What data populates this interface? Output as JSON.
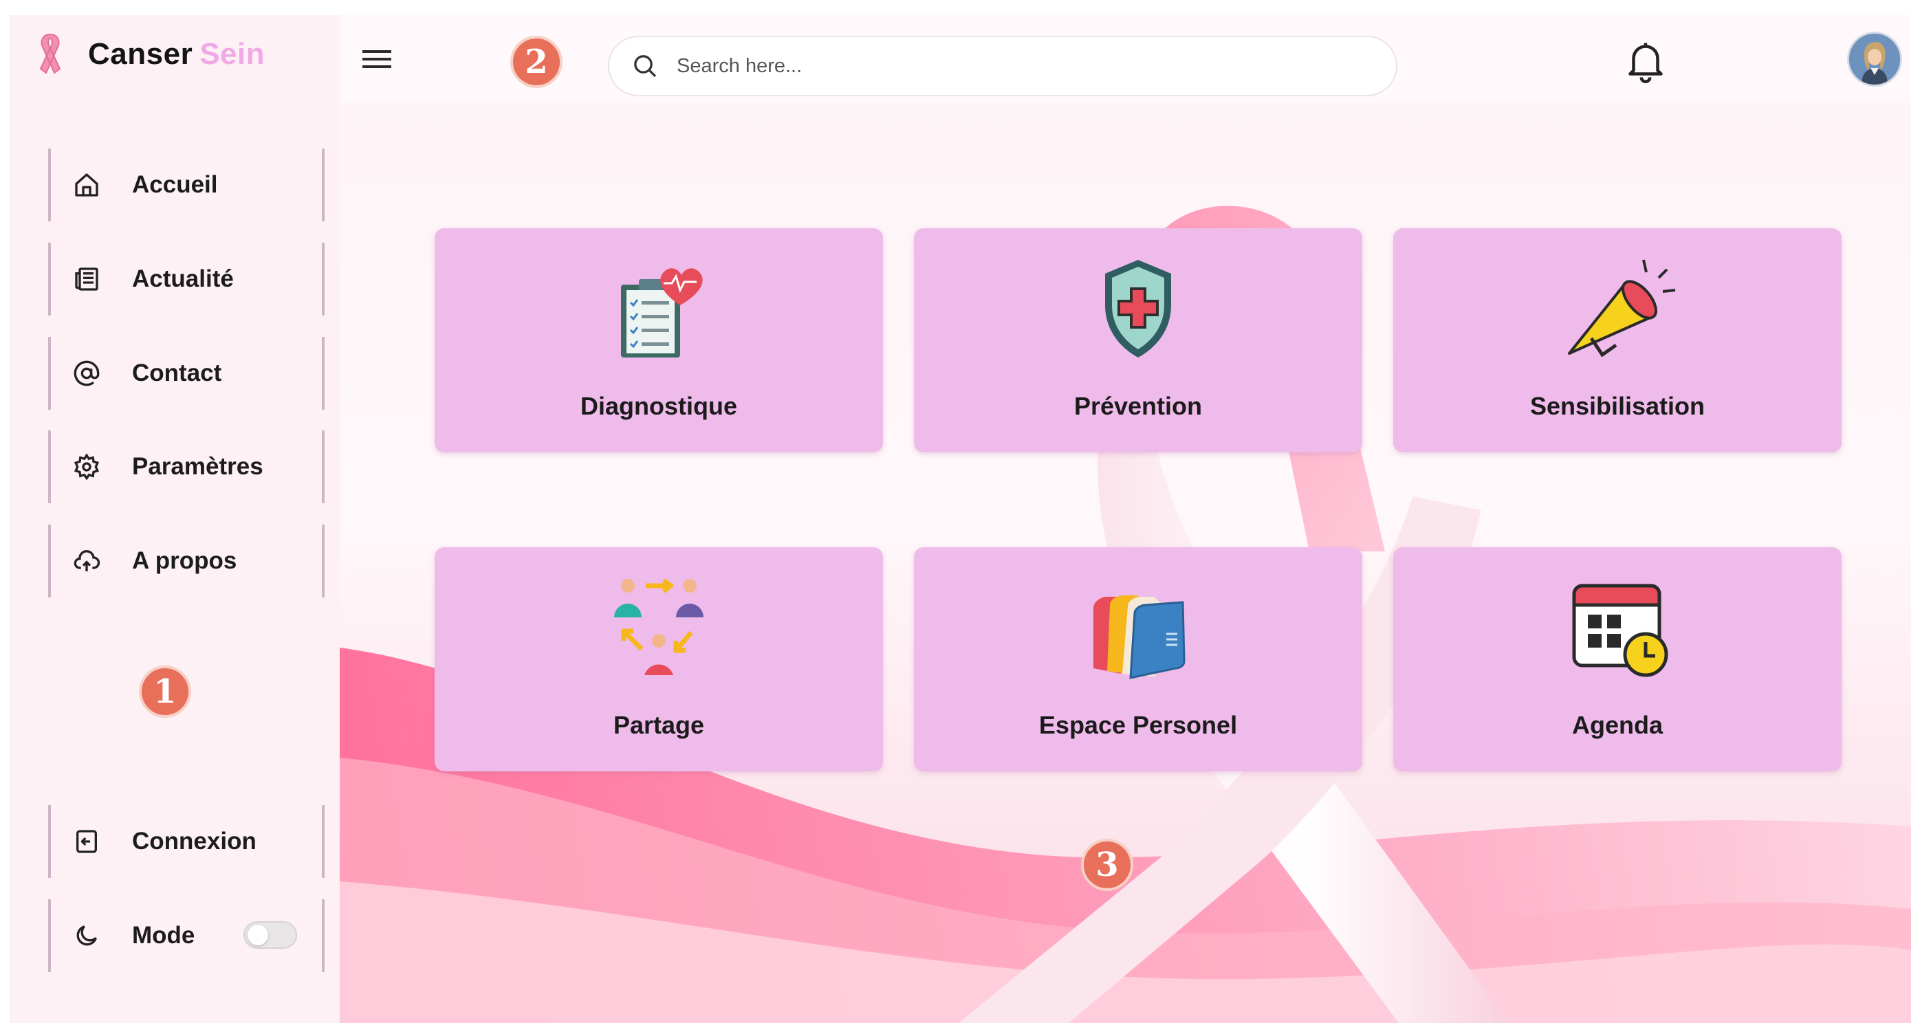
{
  "brand": {
    "name": "Canser",
    "accent": "Sein",
    "accent_color": "#f2a8e6",
    "logo_icon": "pink-ribbon-icon"
  },
  "sidebar": {
    "items": [
      {
        "label": "Accueil",
        "icon": "home-icon"
      },
      {
        "label": "Actualité",
        "icon": "newspaper-icon"
      },
      {
        "label": "Contact",
        "icon": "at-sign-icon"
      },
      {
        "label": "Paramètres",
        "icon": "gear-icon"
      },
      {
        "label": "A propos",
        "icon": "cloud-info-icon"
      }
    ],
    "bottom": [
      {
        "label": "Connexion",
        "icon": "login-icon"
      },
      {
        "label": "Mode",
        "icon": "moon-icon",
        "toggle": false
      }
    ]
  },
  "markers": [
    "1",
    "2",
    "3"
  ],
  "header": {
    "search_placeholder": "Search here...",
    "menu_icon": "hamburger-menu-icon",
    "notification_icon": "bell-icon",
    "avatar_icon": "user-avatar-icon"
  },
  "cards": [
    {
      "label": "Diagnostique",
      "icon": "clipboard-heart-icon"
    },
    {
      "label": "Prévention",
      "icon": "shield-cross-icon"
    },
    {
      "label": "Sensibilisation",
      "icon": "megaphone-icon"
    },
    {
      "label": "Partage",
      "icon": "people-sharing-icon"
    },
    {
      "label": "Espace Personel",
      "icon": "folders-icon"
    },
    {
      "label": "Agenda",
      "icon": "calendar-clock-icon"
    }
  ],
  "colors": {
    "card_bg": "#efbbeb",
    "sidebar_bg": "#fdf1f5",
    "marker": "#e8705a",
    "ribbon": "#f48fb1"
  }
}
